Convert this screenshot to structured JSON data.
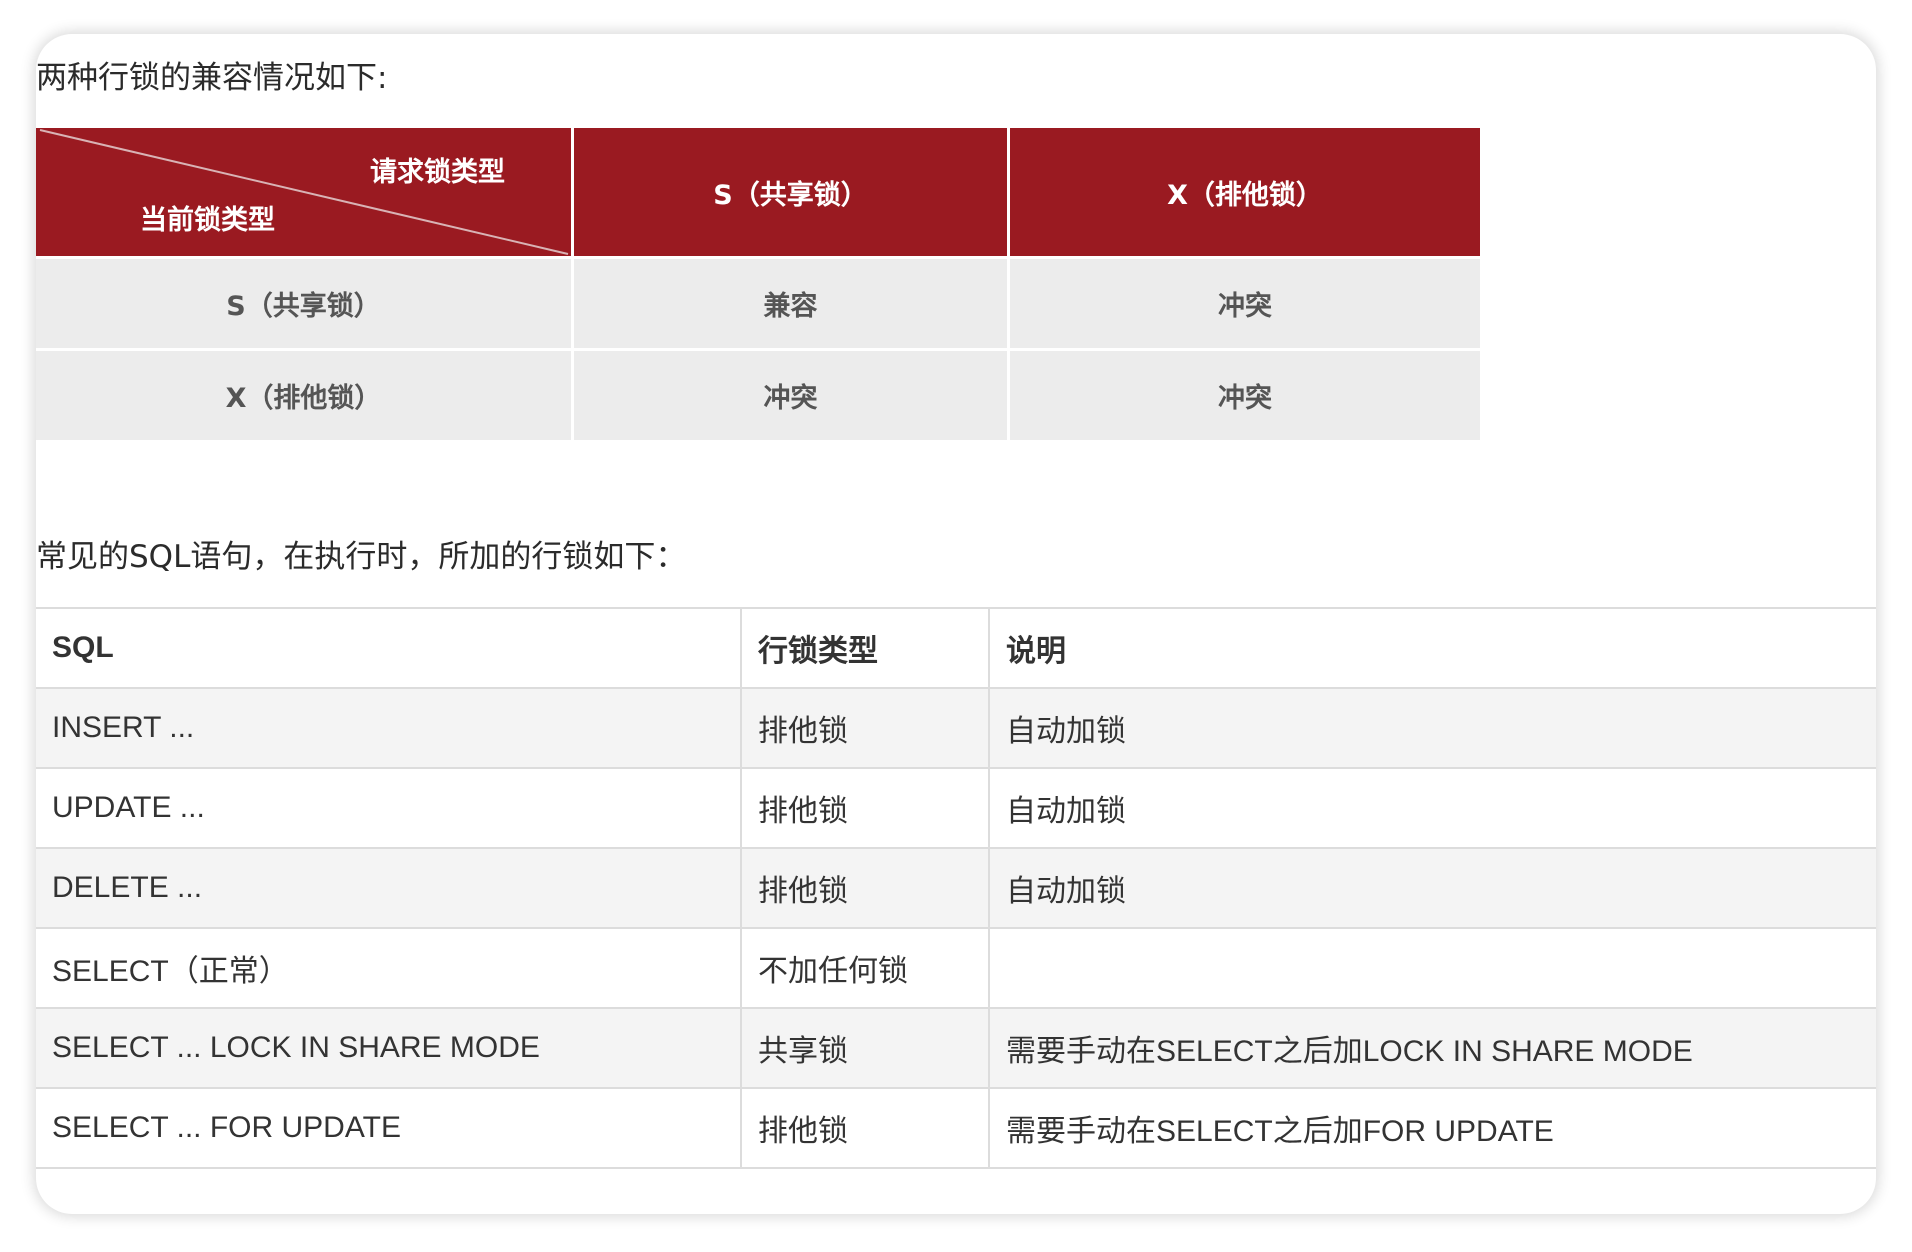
{
  "intro_text": "两种行锁的兼容情况如下:",
  "matrix": {
    "corner_top_right": "请求锁类型",
    "corner_bottom_left": "当前锁类型",
    "col_headers": [
      "S（共享锁）",
      "X（排他锁）"
    ],
    "rows": [
      {
        "label": "S（共享锁）",
        "cells": [
          "兼容",
          "冲突"
        ]
      },
      {
        "label": "X（排他锁）",
        "cells": [
          "冲突",
          "冲突"
        ]
      }
    ],
    "header_color": "#9a1a21"
  },
  "sql_intro_text": "常见的SQL语句，在执行时，所加的行锁如下：",
  "sql_table": {
    "headers": [
      "SQL",
      "行锁类型",
      "说明"
    ],
    "rows": [
      [
        "INSERT ...",
        "排他锁",
        "自动加锁"
      ],
      [
        "UPDATE ...",
        "排他锁",
        "自动加锁"
      ],
      [
        "DELETE ...",
        "排他锁",
        "自动加锁"
      ],
      [
        "SELECT（正常）",
        "不加任何锁",
        ""
      ],
      [
        "SELECT ... LOCK IN SHARE MODE",
        "共享锁",
        "需要手动在SELECT之后加LOCK IN SHARE MODE"
      ],
      [
        "SELECT ... FOR UPDATE",
        "排他锁",
        "需要手动在SELECT之后加FOR UPDATE"
      ]
    ]
  }
}
